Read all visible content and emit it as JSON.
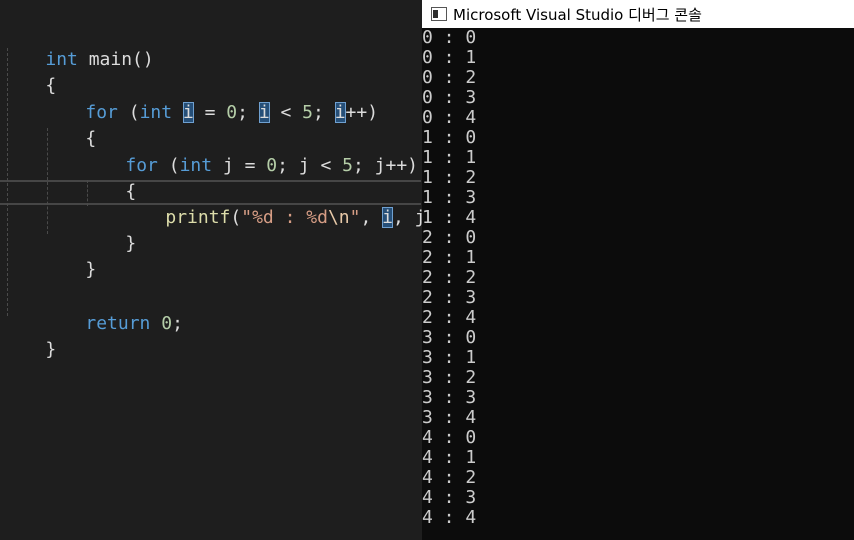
{
  "editor": {
    "lines": [
      [
        "int",
        " main()"
      ],
      [
        "{"
      ],
      [
        "for",
        " (",
        "int",
        " ",
        "i",
        " = ",
        "0",
        "; ",
        "i",
        " < ",
        "5",
        "; ",
        "i",
        "++)"
      ],
      [
        "{"
      ],
      [
        "for",
        " (",
        "int",
        " j = ",
        "0",
        "; j < ",
        "5",
        "; j++)"
      ],
      [
        "{"
      ],
      [
        "printf",
        "(",
        "\"%d : %d",
        "\\n",
        "\"",
        ", ",
        "i",
        ", j);"
      ],
      [
        "}"
      ],
      [
        "}"
      ],
      [
        ""
      ],
      [
        "return",
        " ",
        "0",
        ";"
      ],
      [
        "}"
      ]
    ]
  },
  "console": {
    "title": "Microsoft Visual Studio 디버그 콘솔",
    "output": [
      "0 : 0",
      "0 : 1",
      "0 : 2",
      "0 : 3",
      "0 : 4",
      "1 : 0",
      "1 : 1",
      "1 : 2",
      "1 : 3",
      "1 : 4",
      "2 : 0",
      "2 : 1",
      "2 : 2",
      "2 : 3",
      "2 : 4",
      "3 : 0",
      "3 : 1",
      "3 : 2",
      "3 : 3",
      "3 : 4",
      "4 : 0",
      "4 : 1",
      "4 : 2",
      "4 : 3",
      "4 : 4"
    ]
  },
  "colors": {
    "keyword": "#569cd6",
    "number": "#b5cea8",
    "string": "#d69d85",
    "function": "#dcdcaa",
    "highlight": "#264f78",
    "console_bg": "#0c0c0c",
    "editor_bg": "#1e1e1e"
  }
}
